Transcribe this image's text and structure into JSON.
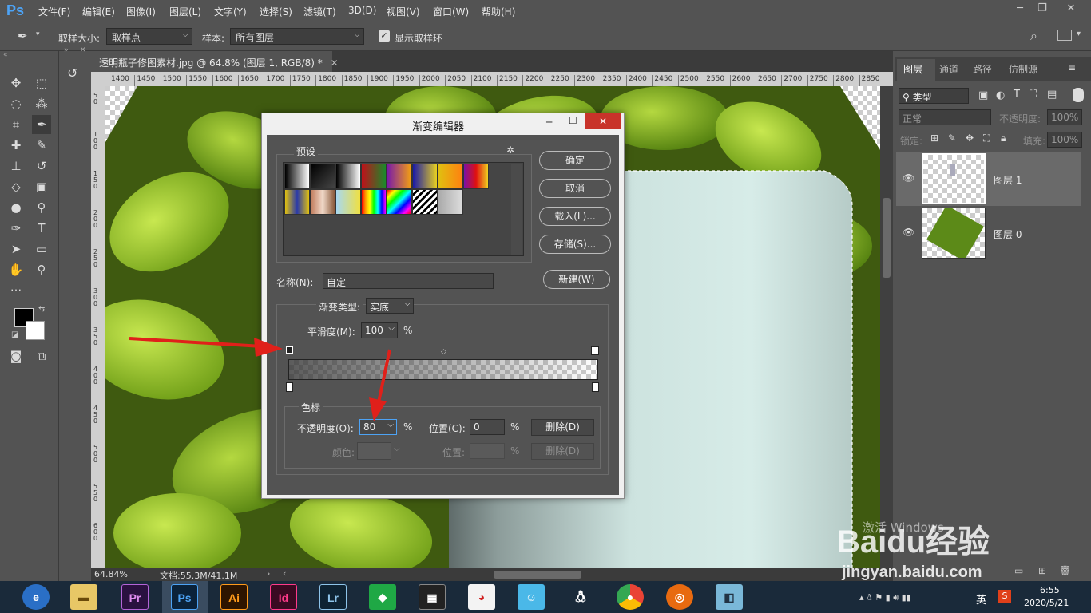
{
  "menubar": {
    "logo": "Ps",
    "items": [
      "文件(F)",
      "编辑(E)",
      "图像(I)",
      "图层(L)",
      "文字(Y)",
      "选择(S)",
      "滤镜(T)",
      "3D(D)",
      "视图(V)",
      "窗口(W)",
      "帮助(H)"
    ]
  },
  "options": {
    "sample_size_label": "取样大小:",
    "sample_size_value": "取样点",
    "sample_label": "样本:",
    "sample_value": "所有图层",
    "show_ring_label": "显示取样环"
  },
  "document": {
    "tab_title": "透明瓶子修图素材.jpg @ 64.8% (图层 1, RGB/8) *",
    "ruler_ticks": [
      "1400",
      "1450",
      "1500",
      "1550",
      "1600",
      "1650",
      "1700",
      "1750",
      "1800",
      "1850",
      "1900",
      "1950",
      "2000",
      "2050",
      "2100",
      "2150",
      "2200",
      "2250",
      "2300",
      "2350",
      "2400",
      "2450",
      "2500",
      "2550",
      "2600",
      "2650",
      "2700",
      "2750",
      "2800",
      "2850"
    ],
    "ruler_v_ticks": [
      "50",
      "100",
      "150",
      "200",
      "250",
      "300",
      "350",
      "400",
      "450",
      "500",
      "550",
      "600"
    ],
    "zoom": "64.84%",
    "doc_info": "文档:55.3M/41.1M"
  },
  "dialog": {
    "title": "渐变编辑器",
    "presets_label": "预设",
    "ok": "确定",
    "cancel": "取消",
    "load": "载入(L)...",
    "save": "存储(S)...",
    "new": "新建(W)",
    "name_label": "名称(N):",
    "name_value": "自定",
    "gradient_type_label": "渐变类型:",
    "gradient_type_value": "实底",
    "smoothness_label": "平滑度(M):",
    "smoothness_value": "100",
    "percent": "%",
    "stops_label": "色标",
    "opacity_label": "不透明度(O):",
    "opacity_value": "80",
    "location_label": "位置(C):",
    "location_value": "0",
    "delete": "删除(D)",
    "color_label": "颜色:",
    "location2_label": "位置:",
    "delete2": "删除(D)"
  },
  "layers_panel": {
    "tabs": [
      "图层",
      "通道",
      "路径",
      "仿制源"
    ],
    "filter_label": "类型",
    "blend_mode": "正常",
    "opacity_label": "不透明度:",
    "opacity_value": "100%",
    "lock_label": "锁定:",
    "fill_label": "填充:",
    "fill_value": "100%",
    "layers": [
      {
        "name": "图层 1"
      },
      {
        "name": "图层 0"
      }
    ]
  },
  "taskbar": {
    "apps": [
      "Pr",
      "Ps",
      "Ai",
      "Id",
      "Lr"
    ],
    "ime": "英",
    "time": "6:55",
    "date": "2020/5/21"
  },
  "watermark": {
    "line1": "Baidu经验",
    "line2": "jingyan.baidu.com",
    "activate": "激活 Windows"
  },
  "colors": {
    "accent_red": "#e0201a",
    "ps_blue": "#4da3f5",
    "panel_bg": "#535353"
  }
}
